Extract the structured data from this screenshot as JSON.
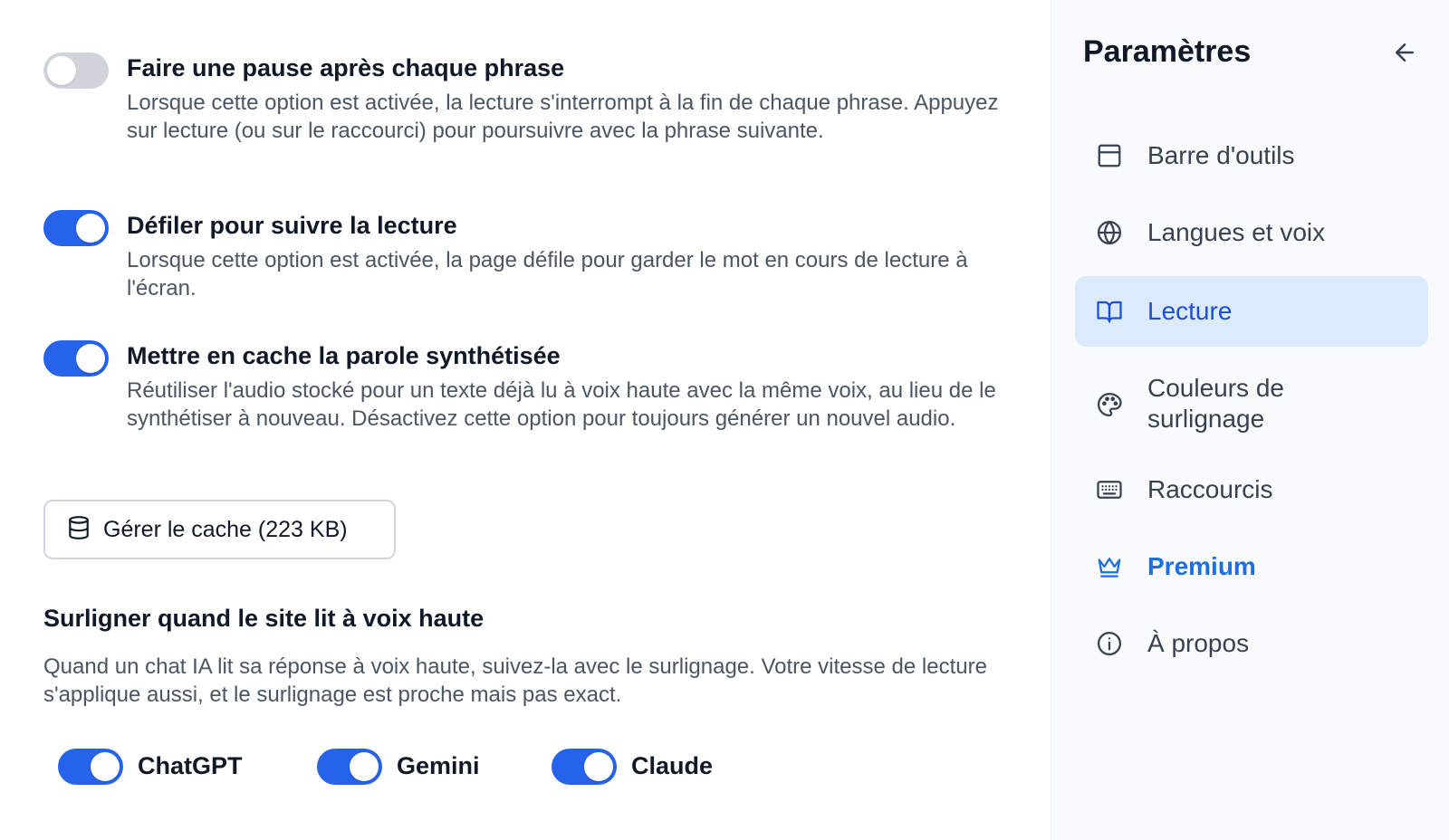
{
  "settings": [
    {
      "title": "Faire une pause après chaque phrase",
      "description": "Lorsque cette option est activée, la lecture s'interrompt à la fin de chaque phrase. Appuyez sur lecture (ou sur le raccourci) pour poursuivre avec la phrase suivante.",
      "enabled": false
    },
    {
      "title": "Défiler pour suivre la lecture",
      "description": "Lorsque cette option est activée, la page défile pour garder le mot en cours de lecture à l'écran.",
      "enabled": true
    },
    {
      "title": "Mettre en cache la parole synthétisée",
      "description": "Réutiliser l'audio stocké pour un texte déjà lu à voix haute avec la même voix, au lieu de le synthétiser à nouveau. Désactivez cette option pour toujours générer un nouvel audio.",
      "enabled": true
    }
  ],
  "cache_button": {
    "label": "Gérer le cache (223 KB)",
    "icon": "database-icon"
  },
  "highlight_section": {
    "title": "Surligner quand le site lit à voix haute",
    "description": "Quand un chat IA lit sa réponse à voix haute, suivez-la avec le surlignage. Votre vitesse de lecture s'applique aussi, et le surlignage est proche mais pas exact.",
    "sites": [
      {
        "name": "ChatGPT",
        "enabled": true
      },
      {
        "name": "Gemini",
        "enabled": true
      },
      {
        "name": "Claude",
        "enabled": true
      }
    ]
  },
  "sidebar": {
    "title": "Paramètres",
    "back_icon": "arrow-left-icon",
    "items": [
      {
        "label": "Barre d'outils",
        "icon": "toolbar-icon",
        "active": false
      },
      {
        "label": "Langues et voix",
        "icon": "globe-icon",
        "active": false
      },
      {
        "label": "Lecture",
        "icon": "book-open-icon",
        "active": true
      },
      {
        "label": "Couleurs de surlignage",
        "icon": "palette-icon",
        "active": false
      },
      {
        "label": "Raccourcis",
        "icon": "keyboard-icon",
        "active": false
      },
      {
        "label": "Premium",
        "icon": "crown-icon",
        "active": false
      },
      {
        "label": "À propos",
        "icon": "info-icon",
        "active": false
      }
    ]
  },
  "colors": {
    "toggle_on": "#2563eb",
    "toggle_off": "#d1d5db",
    "active_nav_bg": "#dbeafe",
    "active_nav_text": "#1d4ed8",
    "premium_text": "#1d6fe0"
  }
}
